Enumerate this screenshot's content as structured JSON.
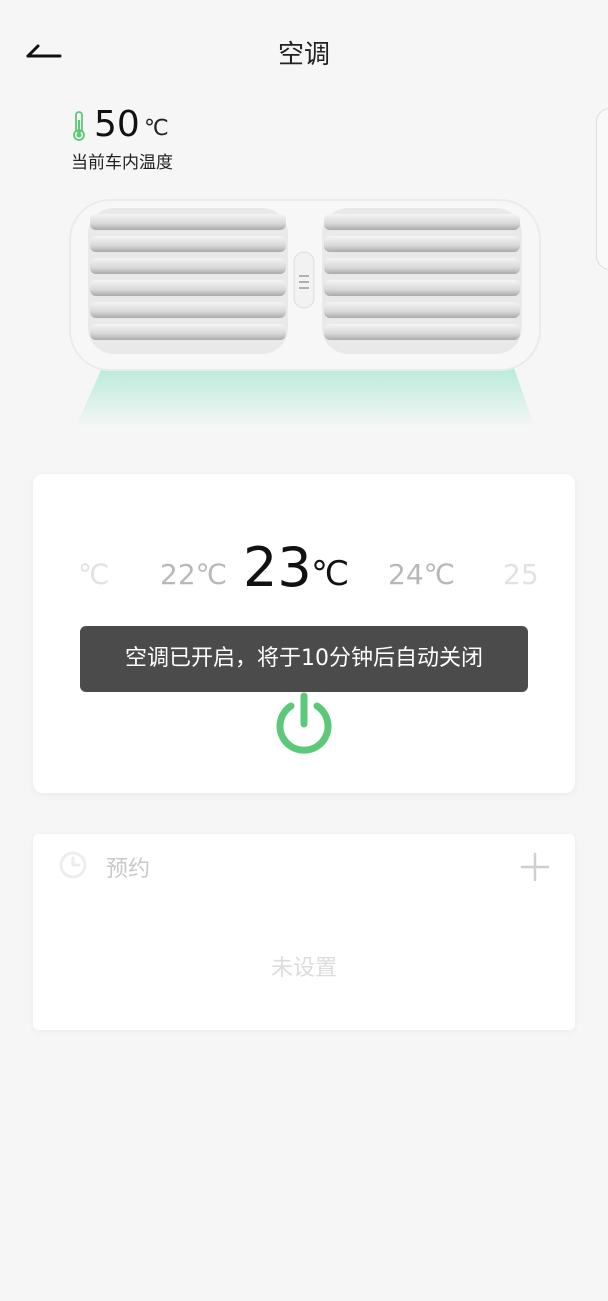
{
  "header": {
    "title": "空调",
    "back_icon": "back-arrow-icon"
  },
  "cabin": {
    "temperature": "50",
    "unit": "℃",
    "label": "当前车内温度",
    "icon": "thermometer-icon"
  },
  "temperature_picker": {
    "options": [
      {
        "text": "℃",
        "style": "far"
      },
      {
        "text": "22℃",
        "style": "near"
      },
      {
        "text": "24℃",
        "style": "near"
      },
      {
        "text": "25",
        "style": "far"
      }
    ],
    "current_value": "23",
    "current_unit": "℃"
  },
  "power": {
    "icon": "power-icon",
    "color": "#5cc97a"
  },
  "toast": {
    "message": "空调已开启，将于10分钟后自动关闭"
  },
  "schedule": {
    "label": "预约",
    "empty_text": "未设置",
    "icon": "clock-icon",
    "add_icon": "plus-icon"
  },
  "colors": {
    "accent": "#5cc97a",
    "airflow": "#7fe0bf",
    "background": "#f6f6f6",
    "toast_bg": "#3c3c3c"
  }
}
